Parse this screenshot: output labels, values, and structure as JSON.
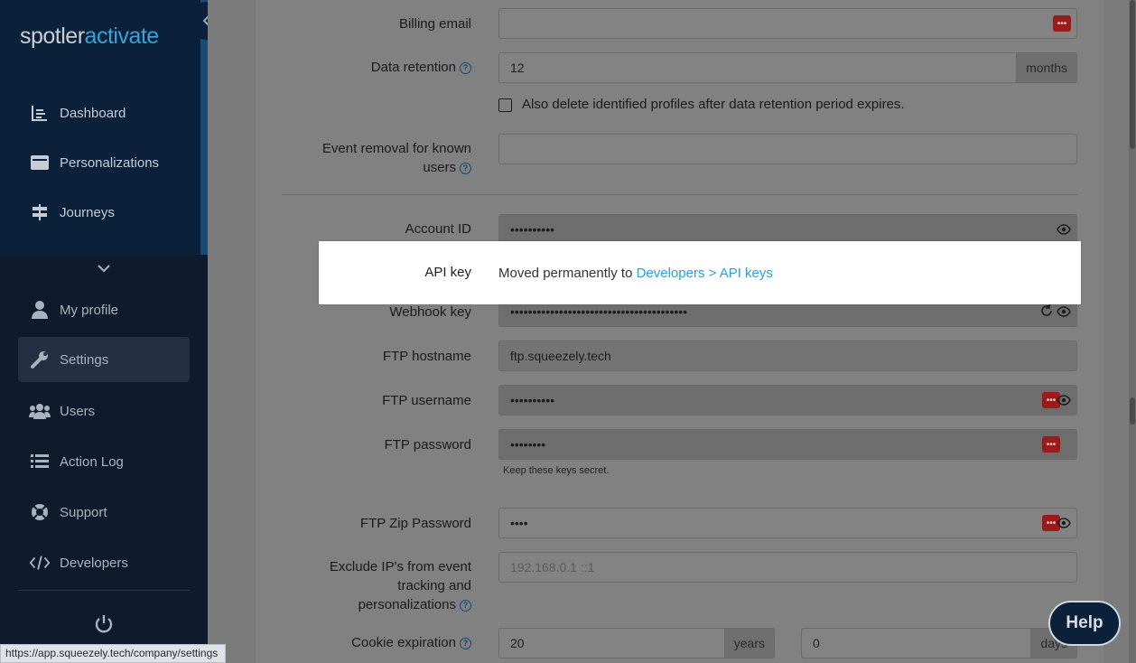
{
  "sidebar": {
    "logo_part1": "spotler",
    "logo_part2": "activate",
    "top_items": [
      {
        "label": "Dashboard",
        "icon": "dashboard-icon"
      },
      {
        "label": "Personalizations",
        "icon": "personalizations-icon"
      },
      {
        "label": "Journeys",
        "icon": "journeys-icon"
      }
    ],
    "bottom_items": [
      {
        "label": "My profile",
        "icon": "user-icon"
      },
      {
        "label": "Settings",
        "icon": "wrench-icon",
        "active": true
      },
      {
        "label": "Users",
        "icon": "users-icon"
      },
      {
        "label": "Action Log",
        "icon": "list-icon"
      },
      {
        "label": "Support",
        "icon": "lifebuoy-icon"
      },
      {
        "label": "Developers",
        "icon": "code-icon"
      }
    ]
  },
  "form": {
    "billing_email": {
      "label": "Billing email",
      "value": ""
    },
    "data_retention": {
      "label": "Data retention",
      "value": "12",
      "addon": "months"
    },
    "delete_profiles": {
      "label": "Also delete identified profiles after data retention period expires."
    },
    "event_removal": {
      "label_line1": "Event removal for known",
      "label_line2": "users",
      "value": ""
    },
    "account_id": {
      "label": "Account ID",
      "value": "••••••••••"
    },
    "api_key": {
      "label": "API key",
      "text": "Moved permanently to ",
      "link": "Developers > API keys"
    },
    "webhook_key": {
      "label": "Webhook key",
      "value": "••••••••••••••••••••••••••••••••••••••••"
    },
    "ftp_hostname": {
      "label": "FTP hostname",
      "value": "ftp.squeezely.tech"
    },
    "ftp_username": {
      "label": "FTP username",
      "value": "••••••••••"
    },
    "ftp_password": {
      "label": "FTP password",
      "value": "••••••••"
    },
    "keys_note": "Keep these keys secret.",
    "ftp_zip_password": {
      "label": "FTP Zip Password",
      "value": "••••"
    },
    "exclude_ips": {
      "label_line1": "Exclude IP's from event",
      "label_line2": "tracking and",
      "label_line3": "personalizations",
      "placeholder": "192.168.0.1 ::1"
    },
    "cookie_expiration": {
      "label": "Cookie expiration",
      "years_value": "20",
      "years_addon": "years",
      "days_value": "0",
      "days_addon": "days"
    }
  },
  "help_button": "Help",
  "status_url": "https://app.squeezely.tech/company/settings",
  "colors": {
    "sidebar": "#0b2139",
    "accent": "#38a3d8",
    "link": "#2f9fd3"
  }
}
